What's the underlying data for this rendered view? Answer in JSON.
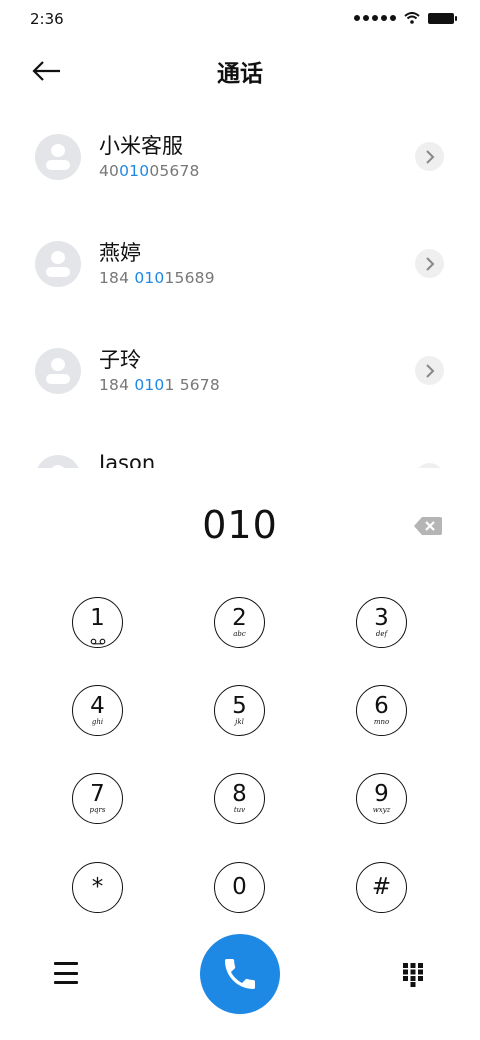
{
  "status_bar": {
    "time": "2:36",
    "icons": [
      "signal-dots-icon",
      "wifi-icon",
      "battery-icon"
    ]
  },
  "header": {
    "title": "通话",
    "back_icon": "arrow-left-icon"
  },
  "contacts": [
    {
      "name": "小米客服",
      "number_parts": [
        "40",
        "010",
        "05678"
      ]
    },
    {
      "name": "燕婷",
      "number_parts": [
        "184 ",
        "010",
        "15689"
      ]
    },
    {
      "name": "子玲",
      "number_parts": [
        "184 ",
        "010",
        "1 5678"
      ]
    },
    {
      "name": "Jason",
      "number_parts": [
        "",
        "",
        ""
      ]
    }
  ],
  "dialer": {
    "input": "010",
    "delete_icon": "backspace-icon",
    "keys": [
      {
        "digit": "1",
        "letters": "voicemail-icon"
      },
      {
        "digit": "2",
        "letters": "abc"
      },
      {
        "digit": "3",
        "letters": "def"
      },
      {
        "digit": "4",
        "letters": "ghi"
      },
      {
        "digit": "5",
        "letters": "jkl"
      },
      {
        "digit": "6",
        "letters": "mno"
      },
      {
        "digit": "7",
        "letters": "pqrs"
      },
      {
        "digit": "8",
        "letters": "tuv"
      },
      {
        "digit": "9",
        "letters": "wxyz"
      },
      {
        "digit": "*",
        "letters": ""
      },
      {
        "digit": "0",
        "letters": ""
      },
      {
        "digit": "#",
        "letters": ""
      }
    ]
  },
  "bottom_bar": {
    "menu_icon": "hamburger-menu-icon",
    "call_icon": "phone-icon",
    "keypad_icon": "dialpad-icon"
  },
  "colors": {
    "accent": "#1e88e5",
    "avatar_bg": "#e3e5e8",
    "text_secondary": "#777777"
  }
}
